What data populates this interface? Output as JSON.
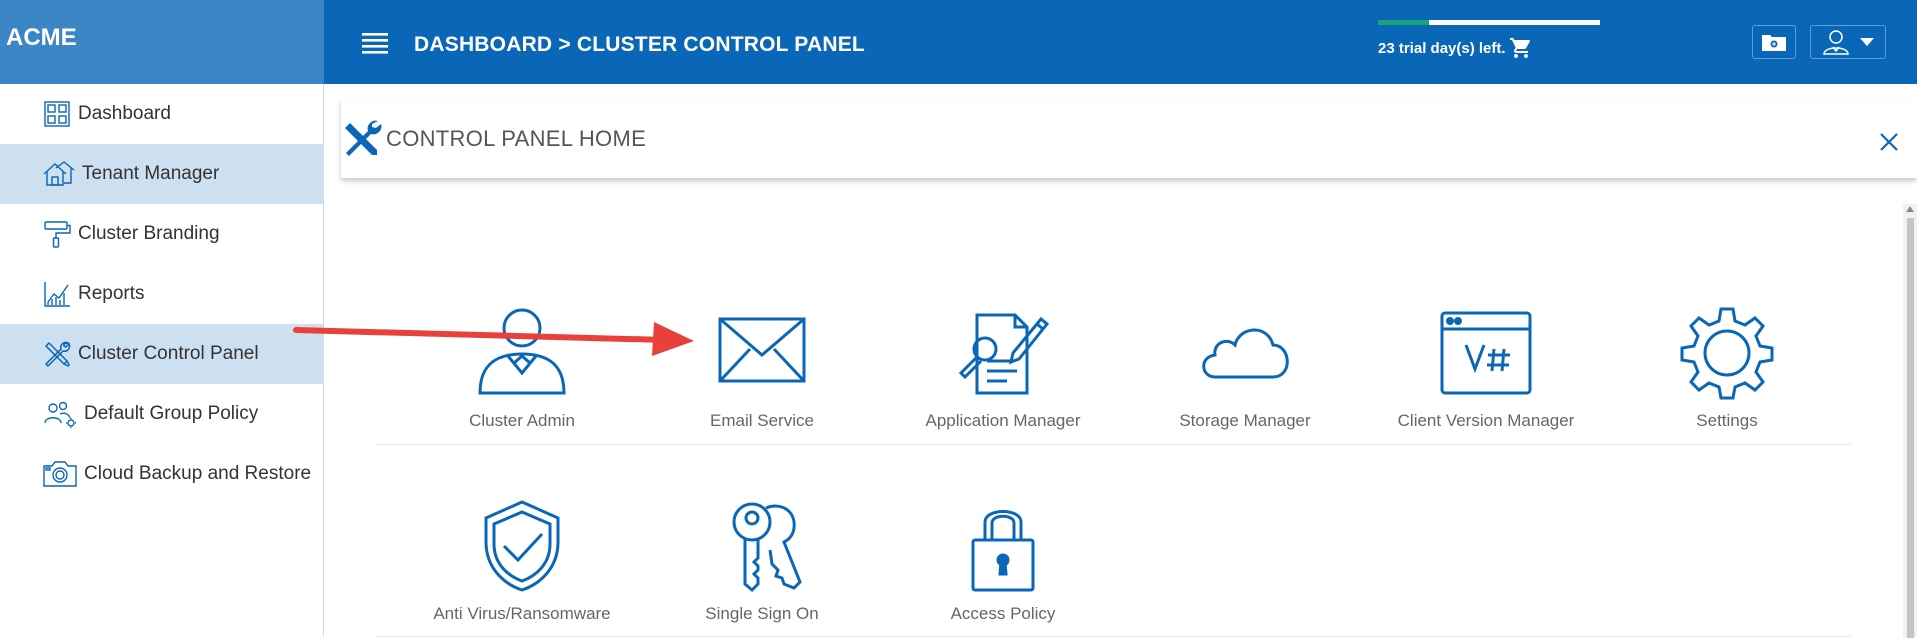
{
  "brand": {
    "name": "ACME"
  },
  "sidebar": {
    "items": [
      {
        "label": "Dashboard",
        "icon": "dashboard-grid-icon",
        "active": false
      },
      {
        "label": "Tenant Manager",
        "icon": "house-icon",
        "active": true
      },
      {
        "label": "Cluster Branding",
        "icon": "paint-roller-icon",
        "active": false
      },
      {
        "label": "Reports",
        "icon": "line-chart-icon",
        "active": false
      },
      {
        "label": "Cluster Control Panel",
        "icon": "tools-icon",
        "active": true
      },
      {
        "label": "Default Group Policy",
        "icon": "group-settings-icon",
        "active": false
      },
      {
        "label": "Cloud Backup and Restore",
        "icon": "camera-icon",
        "active": false
      }
    ]
  },
  "header": {
    "breadcrumb": "DASHBOARD > CLUSTER CONTROL PANEL",
    "trial_text": "23 trial day(s) left.",
    "trial_progress": 0.23
  },
  "panel": {
    "title": "CONTROL PANEL HOME"
  },
  "tiles": {
    "row1": [
      {
        "label": "Cluster Admin",
        "icon": "admin-user-icon"
      },
      {
        "label": "Email Service",
        "icon": "envelope-icon"
      },
      {
        "label": "Application Manager",
        "icon": "document-edit-icon"
      },
      {
        "label": "Storage Manager",
        "icon": "cloud-icon"
      },
      {
        "label": "Client Version Manager",
        "icon": "browser-version-icon"
      },
      {
        "label": "Settings",
        "icon": "gear-icon"
      }
    ],
    "row2": [
      {
        "label": "Anti Virus/Ransomware",
        "icon": "shield-check-icon"
      },
      {
        "label": "Single Sign On",
        "icon": "keys-icon"
      },
      {
        "label": "Access Policy",
        "icon": "padlock-icon"
      }
    ]
  },
  "colors": {
    "topbar": "#0a66b7",
    "brand_bg": "#3d86c6",
    "active_item": "#cde0ef",
    "icon_blue": "#0a66b7",
    "arrow": "#e8413b"
  }
}
